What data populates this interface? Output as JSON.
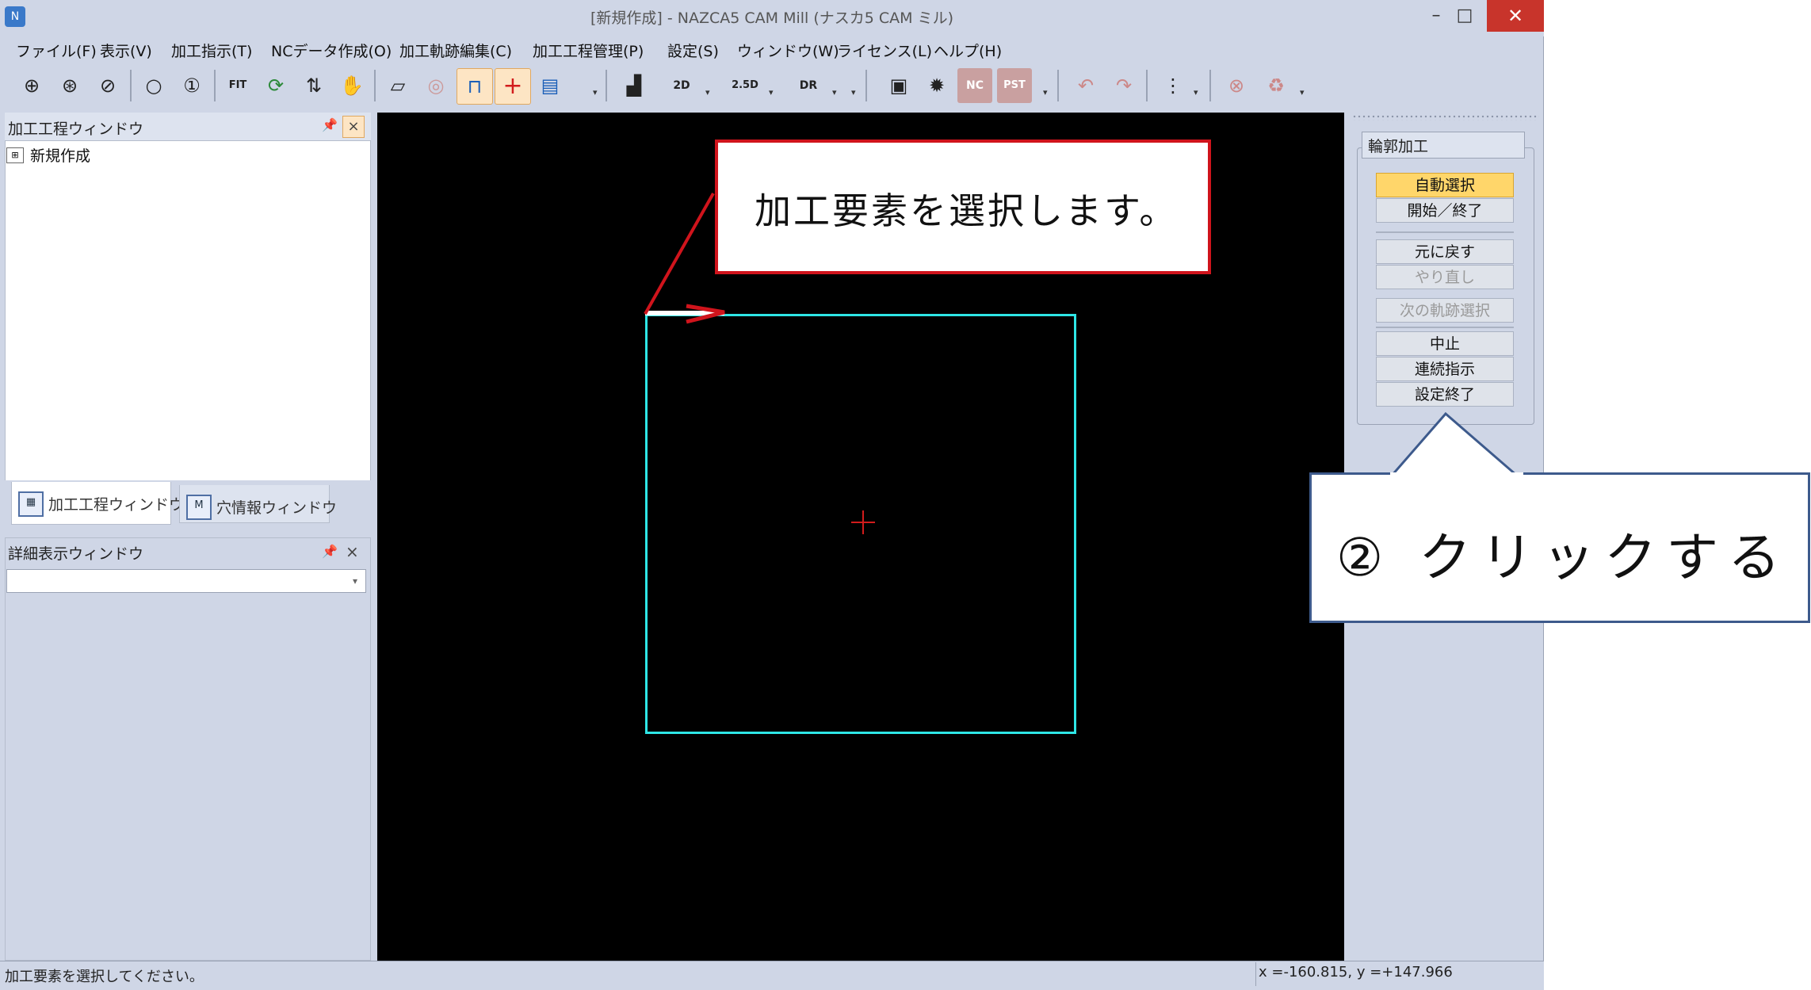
{
  "window": {
    "title": "[新規作成] - NAZCA5 CAM Mill (ナスカ5 CAM ミル)",
    "min_label": "–",
    "max_label": "□",
    "close_label": "✕"
  },
  "menu": [
    "ファイル(F)",
    "表示(V)",
    "加工指示(T)",
    "NCデータ作成(O)",
    "加工軌跡編集(C)",
    "加工工程管理(P)",
    "設定(S)",
    "ウィンドウ(W)",
    "ライセンス(L)",
    "ヘルプ(H)"
  ],
  "toolbar": {
    "icons": [
      "zoom-in",
      "zoom-x2",
      "zoom-half",
      "zoom",
      "zoom-1",
      "fit",
      "redraw",
      "pan-arrows",
      "hand",
      "layer",
      "stock",
      "hole-tool",
      "origin-plus",
      "tool-path",
      "work-setup",
      "2d",
      "2.5d",
      "dr",
      "film",
      "gear-wheel",
      "nc",
      "pst",
      "undo",
      "redo",
      "process-tree",
      "delete-process",
      "trash"
    ],
    "label_2d": "2D",
    "label_25d": "2.5D",
    "label_dr": "DR",
    "label_nc": "NC",
    "label_pst": "PST",
    "label_fit": "FIT"
  },
  "process_window": {
    "title": "加工工程ウィンドウ",
    "tree_item": "新規作成",
    "tabs": [
      "加工工程ウィンドウ",
      "穴情報ウィンドウ"
    ]
  },
  "detail_window": {
    "title": "詳細表示ウィンドウ",
    "select_value": ""
  },
  "callouts": {
    "select_hint": "加工要素を選択します。",
    "click_hint": "② クリックする"
  },
  "right_panel": {
    "title": "輪郭加工",
    "buttons": {
      "auto_select": "自動選択",
      "start_end": "開始／終了",
      "undo": "元に戻す",
      "redo": "やり直し",
      "next_path": "次の軌跡選択",
      "stop": "中止",
      "continuous": "連続指示",
      "finish": "設定終了"
    }
  },
  "status": {
    "message": "加工要素を選択してください。",
    "coords": "x =-160.815,    y =+147.966"
  },
  "colors": {
    "canvas": "#000000",
    "shape": "#2ee6e6",
    "callout_border": "#d0141c",
    "active_button": "#ffd66a"
  }
}
